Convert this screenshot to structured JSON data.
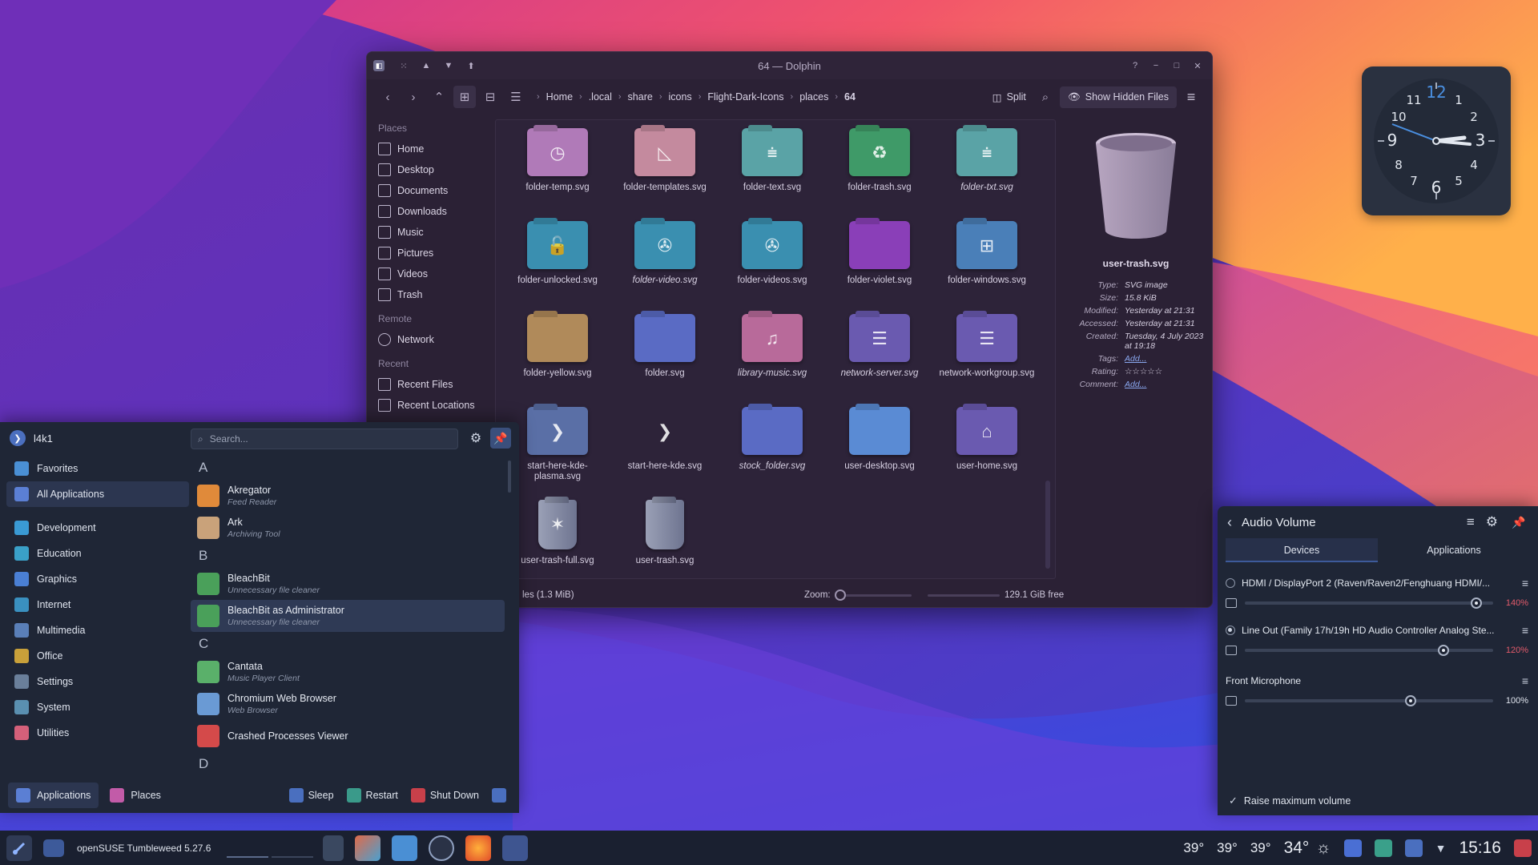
{
  "dolphin": {
    "title": "64 — Dolphin",
    "breadcrumb": [
      "Home",
      ".local",
      "share",
      "icons",
      "Flight-Dark-Icons",
      "places",
      "64"
    ],
    "split_label": "Split",
    "show_hidden_label": "Show Hidden Files",
    "places": {
      "places_heading": "Places",
      "places_items": [
        "Home",
        "Desktop",
        "Documents",
        "Downloads",
        "Music",
        "Pictures",
        "Videos",
        "Trash"
      ],
      "remote_heading": "Remote",
      "remote_items": [
        "Network"
      ],
      "recent_heading": "Recent",
      "recent_items": [
        "Recent Files",
        "Recent Locations"
      ]
    },
    "files": [
      {
        "name": "folder-temp.svg",
        "color": "#b07ab8",
        "glyph": "clock-icon"
      },
      {
        "name": "folder-templates.svg",
        "color": "#c48a9e",
        "glyph": "template-icon"
      },
      {
        "name": "folder-text.svg",
        "color": "#5aa3a6",
        "glyph": "text-icon"
      },
      {
        "name": "folder-trash.svg",
        "color": "#3f9a68",
        "glyph": "recycle-icon"
      },
      {
        "name": "folder-txt.svg",
        "color": "#5aa3a6",
        "glyph": "text-icon",
        "italic": true
      },
      {
        "name": "folder-unlocked.svg",
        "color": "#3a8fb0",
        "glyph": "unlock-icon"
      },
      {
        "name": "folder-video.svg",
        "color": "#3a8fb0",
        "glyph": "film-icon",
        "italic": true
      },
      {
        "name": "folder-videos.svg",
        "color": "#3a8fb0",
        "glyph": "film-icon"
      },
      {
        "name": "folder-violet.svg",
        "color": "#8a3fb8",
        "glyph": ""
      },
      {
        "name": "folder-windows.svg",
        "color": "#4a7fb8",
        "glyph": "windows-icon"
      },
      {
        "name": "folder-yellow.svg",
        "color": "#b08a5a",
        "glyph": ""
      },
      {
        "name": "folder.svg",
        "color": "#5a6bc4",
        "glyph": ""
      },
      {
        "name": "library-music.svg",
        "color": "#b86a9a",
        "glyph": "music-icon",
        "italic": true
      },
      {
        "name": "network-server.svg",
        "color": "#6a5ab0",
        "glyph": "server-icon",
        "italic": true
      },
      {
        "name": "network-workgroup.svg",
        "color": "#6a5ab0",
        "glyph": "server-icon"
      },
      {
        "name": "start-here-kde-plasma.svg",
        "color": "#5a6fa6",
        "glyph": "plasma-icon"
      },
      {
        "name": "start-here-kde.svg",
        "color": "transparent",
        "glyph": "plasma-icon"
      },
      {
        "name": "stock_folder.svg",
        "color": "#5a6bc4",
        "glyph": "",
        "italic": true
      },
      {
        "name": "user-desktop.svg",
        "color": "#5a8bd4",
        "glyph": ""
      },
      {
        "name": "user-home.svg",
        "color": "#6a5ab0",
        "glyph": "home-icon"
      },
      {
        "name": "user-trash-full.svg",
        "color": "#8a90a6",
        "glyph": "trash-full-icon"
      },
      {
        "name": "user-trash.svg",
        "color": "#8a90a6",
        "glyph": "trash-icon"
      }
    ],
    "info": {
      "name": "user-trash.svg",
      "rows": [
        {
          "k": "Type:",
          "v": "SVG image"
        },
        {
          "k": "Size:",
          "v": "15.8 KiB"
        },
        {
          "k": "Modified:",
          "v": "Yesterday at 21:31"
        },
        {
          "k": "Accessed:",
          "v": "Yesterday at 21:31"
        },
        {
          "k": "Created:",
          "v": "Tuesday, 4 July 2023 at 19:18"
        }
      ],
      "tags_label": "Tags:",
      "tags_value": "Add...",
      "rating_label": "Rating:",
      "rating_stars": "☆☆☆☆☆",
      "comment_label": "Comment:",
      "comment_value": "Add..."
    },
    "status": {
      "count": "les (1.3 MiB)",
      "zoom_label": "Zoom:",
      "free": "129.1 GiB free"
    }
  },
  "launcher": {
    "user": "l4k1",
    "search_placeholder": "Search...",
    "categories": [
      "Favorites",
      "All Applications",
      "Development",
      "Education",
      "Graphics",
      "Internet",
      "Multimedia",
      "Office",
      "Settings",
      "System",
      "Utilities"
    ],
    "sections": [
      {
        "letter": "A",
        "apps": [
          {
            "name": "Akregator",
            "desc": "Feed Reader",
            "color": "#e08a3a"
          },
          {
            "name": "Ark",
            "desc": "Archiving Tool",
            "color": "#c9a27a"
          }
        ]
      },
      {
        "letter": "B",
        "apps": [
          {
            "name": "BleachBit",
            "desc": "Unnecessary file cleaner",
            "color": "#4aa05a"
          },
          {
            "name": "BleachBit as Administrator",
            "desc": "Unnecessary file cleaner",
            "color": "#4aa05a",
            "selected": true
          }
        ]
      },
      {
        "letter": "C",
        "apps": [
          {
            "name": "Cantata",
            "desc": "Music Player Client",
            "color": "#5ab06a"
          },
          {
            "name": "Chromium Web Browser",
            "desc": "Web Browser",
            "color": "#6a9ad4"
          },
          {
            "name": "Crashed Processes Viewer",
            "desc": "",
            "color": "#d44a4a"
          }
        ]
      },
      {
        "letter": "D",
        "apps": []
      }
    ],
    "footer": {
      "applications": "Applications",
      "places": "Places",
      "sleep": "Sleep",
      "restart": "Restart",
      "shutdown": "Shut Down"
    }
  },
  "audio": {
    "title": "Audio Volume",
    "tabs": [
      "Devices",
      "Applications"
    ],
    "devices": [
      {
        "name": "HDMI / DisplayPort 2 (Raven/Raven2/Fenghuang HDMI/...",
        "percent": "140%",
        "level": 1.4,
        "over": true,
        "radio": false
      },
      {
        "name": "Line Out (Family 17h/19h HD Audio Controller Analog Ste...",
        "percent": "120%",
        "level": 1.2,
        "over": true,
        "radio": true
      },
      {
        "name": "Front Microphone",
        "percent": "100%",
        "level": 1.0,
        "over": false,
        "radio": null
      }
    ],
    "raise_label": "Raise maximum volume"
  },
  "taskbar": {
    "task_title": "openSUSE Tumbleweed 5.27.6",
    "temps": [
      "39°",
      "39°",
      "39°"
    ],
    "weather_temp": "34°",
    "time": "15:16"
  },
  "colors": {
    "accent": "#3d5a9a",
    "over_volume": "#e25b6b"
  }
}
